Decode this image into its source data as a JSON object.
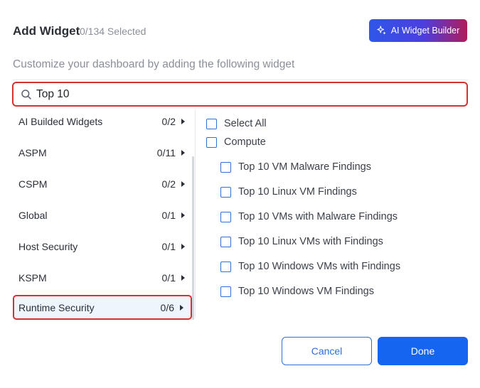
{
  "header": {
    "title": "Add Widget",
    "selected_count": "0/134 Selected",
    "ai_builder_label": "AI Widget Builder"
  },
  "subtitle": "Customize your dashboard by adding the following widget",
  "search": {
    "value": "Top 10"
  },
  "categories": [
    {
      "label": "AI Builded Widgets",
      "count": "0/2"
    },
    {
      "label": "ASPM",
      "count": "0/11"
    },
    {
      "label": "CSPM",
      "count": "0/2"
    },
    {
      "label": "Global",
      "count": "0/1"
    },
    {
      "label": "Host Security",
      "count": "0/1"
    },
    {
      "label": "KSPM",
      "count": "0/1"
    },
    {
      "label": "Runtime Security",
      "count": "0/6",
      "active": true
    }
  ],
  "widgets": {
    "select_all": "Select All",
    "group": "Compute",
    "items": [
      "Top 10 VM Malware Findings",
      "Top 10 Linux VM Findings",
      "Top 10 VMs with Malware Findings",
      "Top 10 Linux VMs with Findings",
      "Top 10 Windows VMs with Findings",
      "Top 10 Windows VM Findings"
    ]
  },
  "footer": {
    "cancel_label": "Cancel",
    "done_label": "Done"
  },
  "colors": {
    "accent": "#1565f0",
    "highlight": "#d8302f",
    "active_bg": "#eef5fd"
  }
}
